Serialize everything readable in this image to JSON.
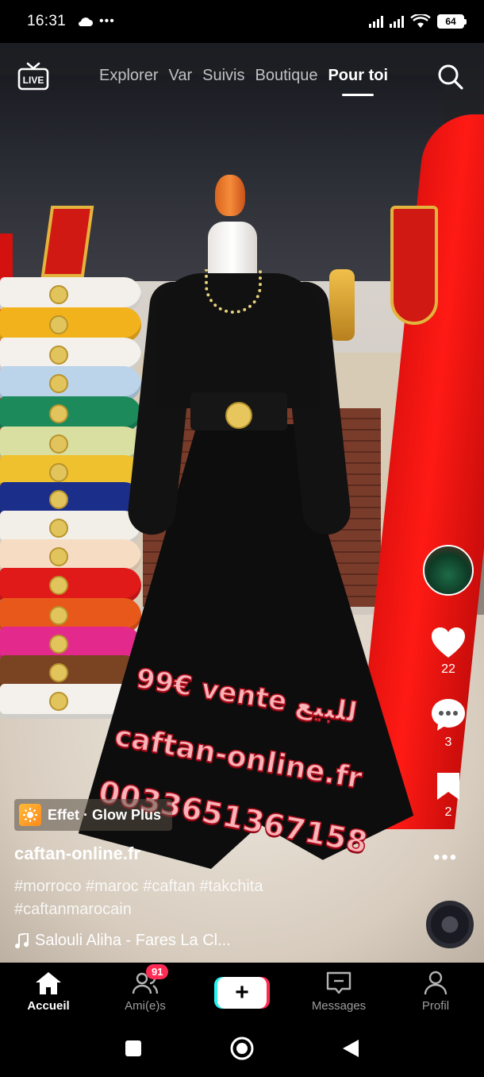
{
  "status_bar": {
    "time": "16:31",
    "dots": "•••",
    "battery": "64"
  },
  "top_nav": {
    "tabs": [
      "Explorer",
      "Var",
      "Suivis",
      "Boutique",
      "Pour toi"
    ],
    "active_tab": "Pour toi"
  },
  "video": {
    "overlay_lines": [
      "99€ vente للبيع",
      "caftan-online.fr",
      "0033651367158"
    ]
  },
  "actions": {
    "likes": "22",
    "comments": "3",
    "bookmarks": "2"
  },
  "post": {
    "effect_label": "Effet · Glow Plus",
    "author": "caftan-online.fr",
    "caption_line1": "#morroco #maroc #caftan #takchita",
    "caption_line2": "#caftanmarocain",
    "music": "Salouli Aliha - Fares La Cl..."
  },
  "bottom_nav": {
    "home": "Accueil",
    "friends": "Ami(e)s",
    "friends_badge": "91",
    "messages": "Messages",
    "profile": "Profil"
  },
  "colors": {
    "accent_red": "#fe2c55",
    "accent_cyan": "#25f4ee",
    "overlay_text": "#f7b4b9"
  },
  "icons": [
    "live-icon",
    "search-icon",
    "heart-icon",
    "comment-icon",
    "bookmark-icon",
    "more-icon",
    "music-note-icon",
    "home-icon",
    "friends-icon",
    "create-icon",
    "messages-icon",
    "profile-icon",
    "recents-icon",
    "home-circle-icon",
    "back-icon"
  ]
}
